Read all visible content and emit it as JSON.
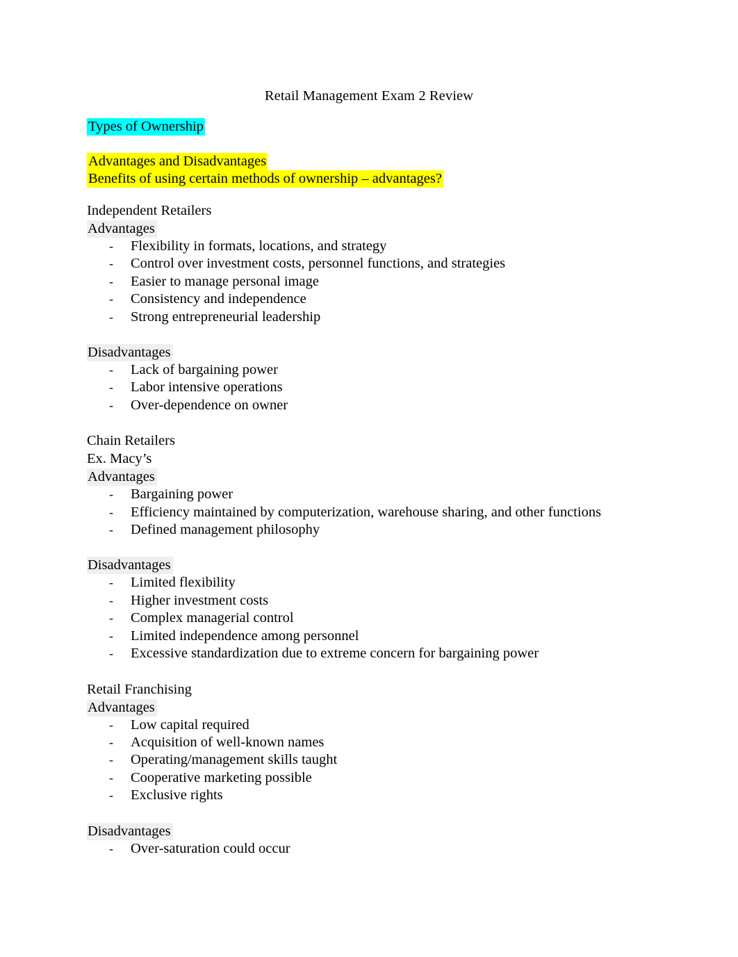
{
  "document": {
    "title": "Retail Management Exam 2 Review",
    "highlight_colors": {
      "cyan": "#00FFFF",
      "yellow": "#FFFF00",
      "gray_shade": "#EFEFF0"
    },
    "bullet_marker": "-"
  },
  "intro": {
    "topic_heading": "Types of Ownership",
    "prompt_line_1": "Advantages and Disadvantages",
    "prompt_line_2": "Benefits of using certain methods of ownership – advantages?"
  },
  "sections": [
    {
      "heading": "Independent Retailers",
      "example": "",
      "advantages_label": "Advantages",
      "advantages": [
        "Flexibility in formats, locations, and strategy",
        "Control over investment costs, personnel functions, and strategies",
        "Easier to manage personal image",
        "Consistency and independence",
        "Strong entrepreneurial leadership"
      ],
      "disadvantages_label": "Disadvantages",
      "disadvantages": [
        "Lack of bargaining power",
        "Labor intensive operations",
        "Over-dependence on owner"
      ]
    },
    {
      "heading": "Chain Retailers",
      "example": "Ex. Macy’s",
      "advantages_label": "Advantages",
      "advantages": [
        "Bargaining power",
        "Efficiency maintained by computerization, warehouse sharing, and other functions",
        "Defined management philosophy"
      ],
      "disadvantages_label": "Disadvantages",
      "disadvantages": [
        "Limited flexibility",
        "Higher investment costs",
        "Complex managerial control",
        "Limited independence among personnel",
        "Excessive standardization due to extreme concern for bargaining power"
      ]
    },
    {
      "heading": "Retail Franchising",
      "example": "",
      "advantages_label": "Advantages",
      "advantages": [
        "Low capital required",
        "Acquisition of well-known names",
        "Operating/management skills taught",
        "Cooperative marketing possible",
        "Exclusive rights"
      ],
      "disadvantages_label": "Disadvantages",
      "disadvantages": [
        "Over-saturation could occur"
      ]
    }
  ]
}
